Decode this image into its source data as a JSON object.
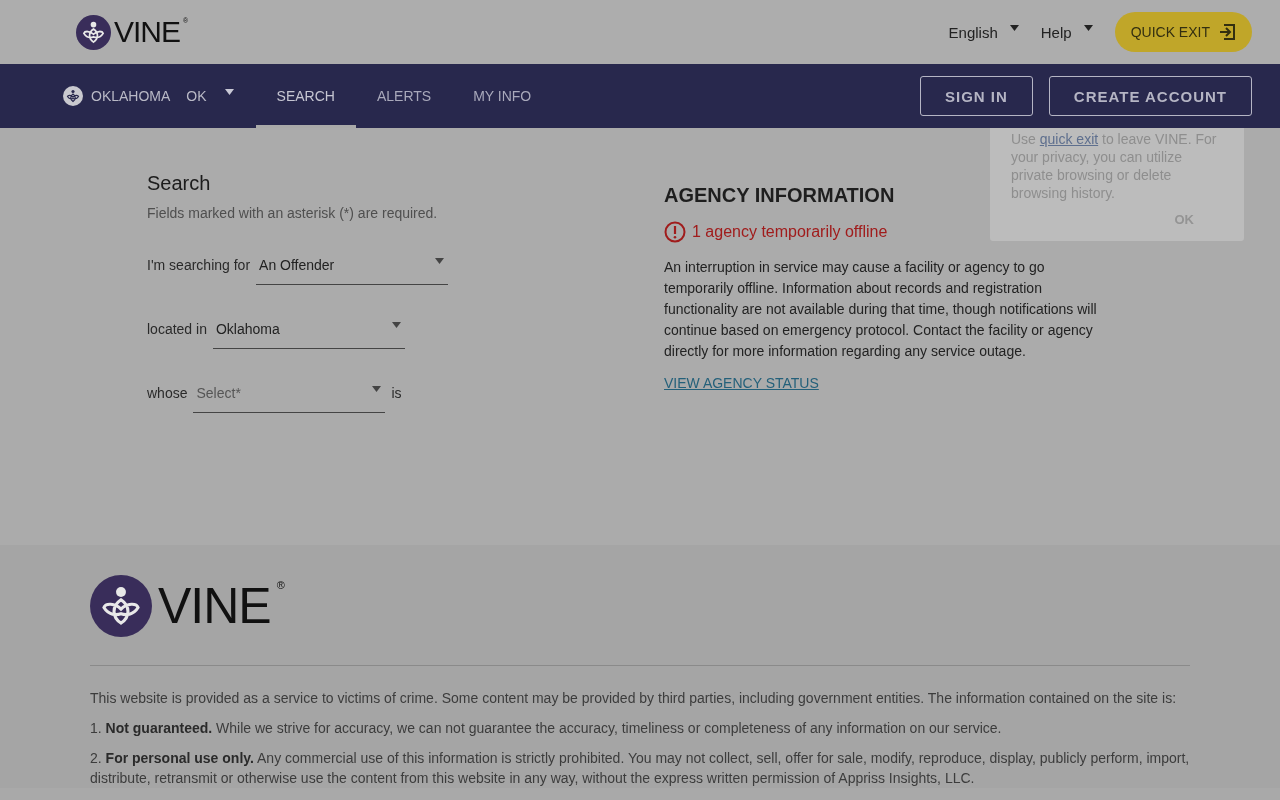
{
  "header": {
    "logo_text": "VINE",
    "logo_mark": "®",
    "language": "English",
    "help": "Help",
    "quick_exit": "QUICK EXIT"
  },
  "nav": {
    "state": "OKLAHOMA",
    "state_code": "OK",
    "tabs": [
      {
        "label": "SEARCH",
        "selected": true
      },
      {
        "label": "ALERTS",
        "selected": false
      },
      {
        "label": "MY INFO",
        "selected": false
      }
    ],
    "sign_in": "SIGN IN",
    "create_account": "CREATE ACCOUNT"
  },
  "popover": {
    "text_before": "Use",
    "link": "quick exit",
    "text_after": "to leave VINE. For your privacy, you can utilize private browsing or delete browsing history.",
    "button": "OK"
  },
  "search": {
    "title": "Search",
    "hint": "Fields marked with an asterisk (*) are required.",
    "rows": [
      {
        "label": "I'm searching for",
        "value": "An Offender"
      },
      {
        "label": "located in",
        "value": "Oklahoma"
      },
      {
        "label": "whose",
        "placeholder": "Select*",
        "suffix": "is"
      }
    ]
  },
  "agency": {
    "title": "AGENCY INFORMATION",
    "alert": "1 agency temporarily offline",
    "body": "An interruption in service may cause a facility or agency to go temporarily offline. Information about records and registration functionality are not available during that time, though notifications will continue based on emergency protocol. Contact the facility or agency directly for more information regarding any service outage.",
    "link": "VIEW AGENCY STATUS"
  },
  "footer": {
    "logo_text": "VINE",
    "logo_mark": "®",
    "paragraphs": [
      "This website is provided as a service to victims of crime. Some content may be provided by third parties, including government entities. The information contained on the site is:",
      "1. **Not guaranteed.** While we strive for accuracy, we can not guarantee the accuracy, timeliness or completeness of any information on our service.",
      "2. **For personal use only.** Any commercial use of this information is strictly prohibited. You may not collect, sell, offer for sale, modify, reproduce, display, publicly perform, import, distribute, retransmit or otherwise use the content from this website in any way, without the express written permission of Appriss Insights, LLC."
    ]
  }
}
